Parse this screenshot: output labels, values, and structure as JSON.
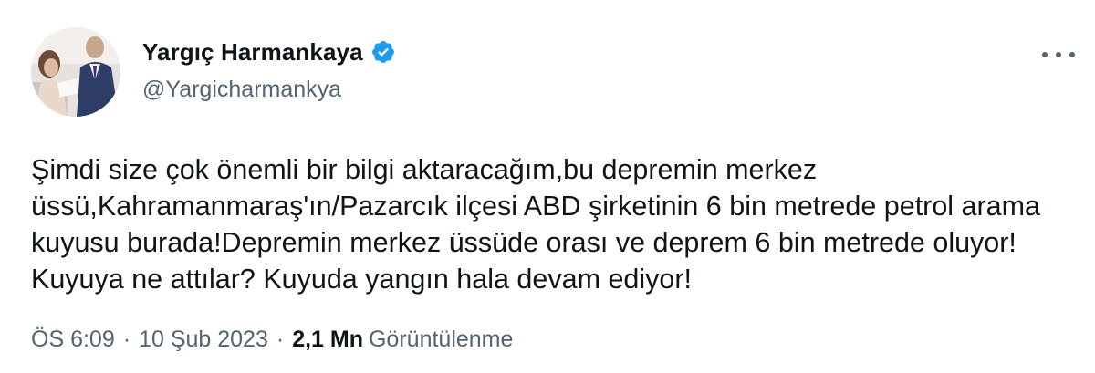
{
  "author": {
    "display_name": "Yargıç Harmankaya",
    "handle": "@Yargicharmankya",
    "verified_icon": "verified-badge-icon",
    "verified_color": "#1d9bf0"
  },
  "more_icon": "more-options-icon",
  "tweet": {
    "text": "Şimdi size çok önemli bir bilgi aktaracağım,bu depremin merkez üssü,Kahramanmaraş'ın/Pazarcık ilçesi ABD şirketinin 6 bin metrede petrol arama kuyusu burada!Depremin merkez üssüde orası ve deprem 6 bin metrede oluyor! Kuyuya ne attılar? Kuyuda yangın hala devam ediyor!"
  },
  "meta": {
    "time": "ÖS 6:09",
    "separator": "·",
    "date": "10 Şub 2023",
    "views_count": "2,1 Mn",
    "views_label": "Görüntülenme"
  },
  "colors": {
    "text_primary": "#0f1419",
    "text_secondary": "#536471",
    "background": "#ffffff"
  }
}
